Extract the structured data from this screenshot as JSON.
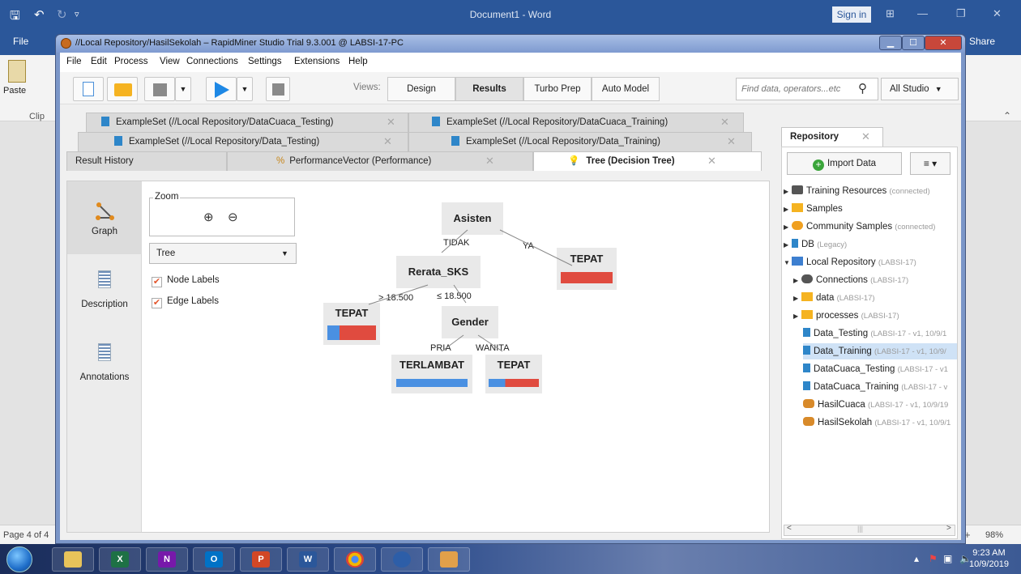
{
  "word": {
    "title": "Document1 - Word",
    "sign_in": "Sign in",
    "file_tab": "File",
    "share": "Share",
    "paste": "Paste",
    "clipboard": "Clip",
    "status_page": "Page 4 of 4",
    "zoom": "98%"
  },
  "window": {
    "title": "//Local Repository/HasilSekolah – RapidMiner Studio Trial 9.3.001 @ LABSI-17-PC"
  },
  "menu": [
    "File",
    "Edit",
    "Process",
    "View",
    "Connections",
    "Settings",
    "Extensions",
    "Help"
  ],
  "toolbar": {
    "views_label": "Views:",
    "views": [
      "Design",
      "Results",
      "Turbo Prep",
      "Auto Model"
    ],
    "active_view": "Results",
    "search_placeholder": "Find data, operators...etc",
    "scope": "All Studio"
  },
  "tabs": {
    "row1": [
      "ExampleSet (//Local Repository/DataCuaca_Testing)",
      "ExampleSet (//Local Repository/DataCuaca_Training)"
    ],
    "row2": [
      "ExampleSet (//Local Repository/Data_Testing)",
      "ExampleSet (//Local Repository/Data_Training)"
    ],
    "row3": [
      "Result History",
      "PerformanceVector (Performance)",
      "Tree (Decision Tree)"
    ]
  },
  "sidenav": [
    "Graph",
    "Description",
    "Annotations"
  ],
  "controls": {
    "zoom_legend": "Zoom",
    "layout_select": "Tree",
    "node_labels": "Node Labels",
    "edge_labels": "Edge Labels"
  },
  "tree": {
    "root": "Asisten",
    "edge_tidak": "TIDAK",
    "edge_ya": "YA",
    "node_rerata": "Rerata_SKS",
    "leaf_ya": "TEPAT",
    "edge_gt": "> 18.500",
    "edge_le": "≤ 18.500",
    "leaf_gt": "TEPAT",
    "node_gender": "Gender",
    "edge_pria": "PRIA",
    "edge_wanita": "WANITA",
    "leaf_pria": "TERLAMBAT",
    "leaf_wanita": "TEPAT",
    "colors": {
      "blue": "#4a90e2",
      "red": "#e04b3f"
    },
    "leaf_ya_blue_fraction": 0.0,
    "leaf_gt_blue_fraction": 0.25,
    "leaf_pria_blue_fraction": 1.0,
    "leaf_wanita_blue_fraction": 0.33
  },
  "repository": {
    "tab": "Repository",
    "import": "Import Data",
    "items": [
      {
        "label": "Training Resources",
        "meta": "(connected)"
      },
      {
        "label": "Samples",
        "meta": ""
      },
      {
        "label": "Community Samples",
        "meta": "(connected)"
      },
      {
        "label": "DB",
        "meta": "(Legacy)"
      },
      {
        "label": "Local Repository",
        "meta": "(LABSI-17)"
      },
      {
        "label": "Connections",
        "meta": "(LABSI-17)"
      },
      {
        "label": "data",
        "meta": "(LABSI-17)"
      },
      {
        "label": "processes",
        "meta": "(LABSI-17)"
      },
      {
        "label": "Data_Testing",
        "meta": "(LABSI-17 - v1, 10/9/1"
      },
      {
        "label": "Data_Training",
        "meta": "(LABSI-17 - v1, 10/9/"
      },
      {
        "label": "DataCuaca_Testing",
        "meta": "(LABSI-17 - v1"
      },
      {
        "label": "DataCuaca_Training",
        "meta": "(LABSI-17 - v"
      },
      {
        "label": "HasilCuaca",
        "meta": "(LABSI-17 - v1, 10/9/19"
      },
      {
        "label": "HasilSekolah",
        "meta": "(LABSI-17 - v1, 10/9/1"
      }
    ]
  },
  "clock": {
    "time": "9:23 AM",
    "date": "10/9/2019"
  }
}
